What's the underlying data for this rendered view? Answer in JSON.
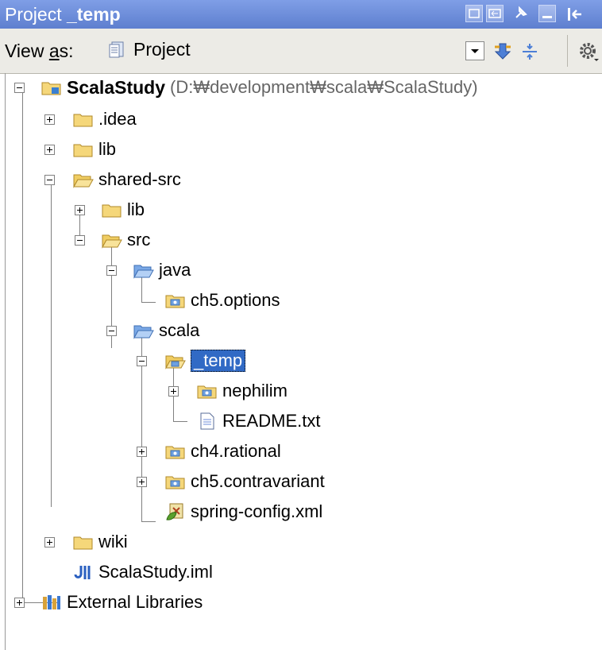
{
  "window": {
    "title_prefix": "Project",
    "title_name": "_temp",
    "buttons": [
      "restore-icon",
      "move-icon",
      "pin-icon",
      "minimize-icon",
      "hide-icon"
    ]
  },
  "toolbar": {
    "view_as_pre": "View ",
    "view_as_ul": "a",
    "view_as_post": "s:",
    "view_mode": "Project",
    "icons": [
      "dropdown-arrow-icon",
      "autoscroll-icon",
      "collapse-all-icon",
      "settings-icon"
    ]
  },
  "tree": {
    "root": {
      "label": "ScalaStudy",
      "path": "(D:₩development₩scala₩ScalaStudy)"
    },
    "items": [
      {
        "label": ".idea"
      },
      {
        "label": "lib"
      },
      {
        "label": "shared-src"
      },
      {
        "label": "lib"
      },
      {
        "label": "src"
      },
      {
        "label": "java"
      },
      {
        "label": "ch5.options"
      },
      {
        "label": "scala"
      },
      {
        "label": "_temp"
      },
      {
        "label": "nephilim"
      },
      {
        "label": "README.txt"
      },
      {
        "label": "ch4.rational"
      },
      {
        "label": "ch5.contravariant"
      },
      {
        "label": "spring-config.xml"
      },
      {
        "label": "wiki"
      },
      {
        "label": "ScalaStudy.iml"
      },
      {
        "label": "External Libraries"
      }
    ]
  },
  "colors": {
    "titlebar": "#6b8bd8",
    "selection": "#316ac5",
    "folder": "#f5d77a",
    "source_folder": "#8fb8f0"
  }
}
